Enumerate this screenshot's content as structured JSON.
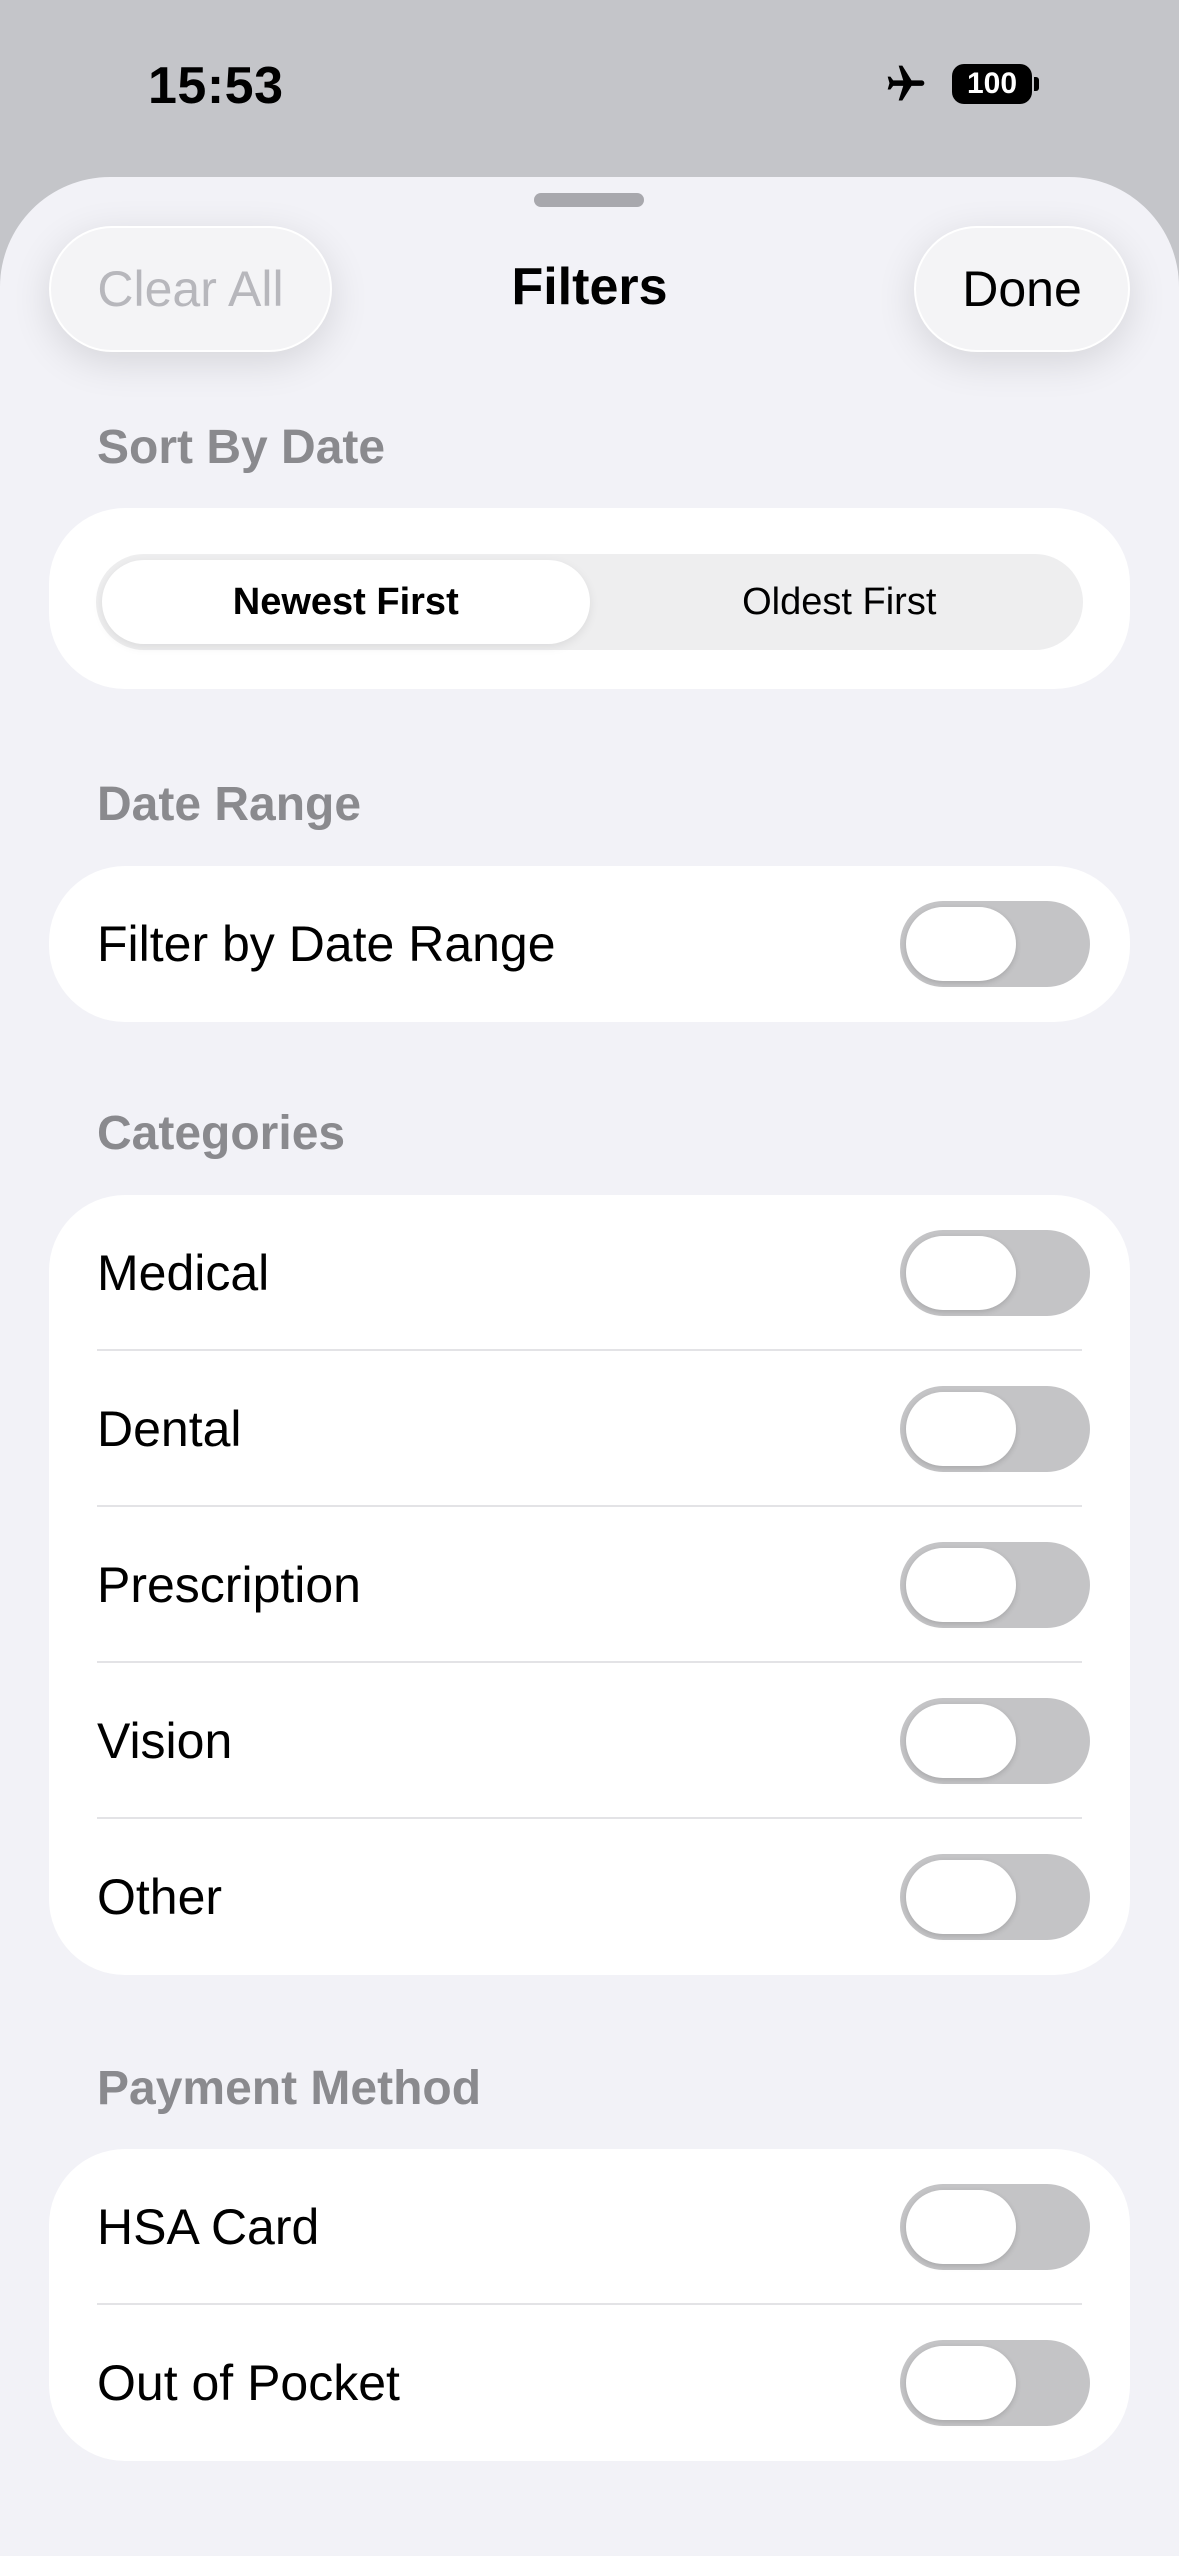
{
  "status_bar": {
    "time": "15:53",
    "battery": "100",
    "airplane_icon": "airplane-icon"
  },
  "header": {
    "title": "Filters",
    "clear_label": "Clear All",
    "done_label": "Done"
  },
  "sort_section": {
    "header": "Sort By Date",
    "options": [
      "Newest First",
      "Oldest First"
    ],
    "selected": "Newest First"
  },
  "date_range_section": {
    "header": "Date Range",
    "rows": [
      {
        "label": "Filter by Date Range",
        "on": false
      }
    ]
  },
  "categories_section": {
    "header": "Categories",
    "rows": [
      {
        "label": "Medical",
        "on": false
      },
      {
        "label": "Dental",
        "on": false
      },
      {
        "label": "Prescription",
        "on": false
      },
      {
        "label": "Vision",
        "on": false
      },
      {
        "label": "Other",
        "on": false
      }
    ]
  },
  "payment_section": {
    "header": "Payment Method",
    "rows": [
      {
        "label": "HSA Card",
        "on": false
      },
      {
        "label": "Out of Pocket",
        "on": false
      }
    ]
  },
  "colors": {
    "toggle_off": "#c4c4c6",
    "sheet_background": "#f2f2f7",
    "section_header": "#8a8a8e"
  }
}
